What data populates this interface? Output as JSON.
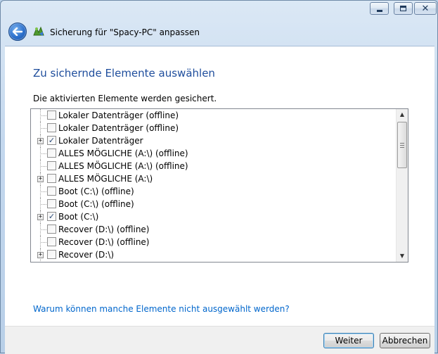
{
  "window": {
    "title": "Sicherung für \"Spacy-PC\" anpassen",
    "controls": {
      "minimize": "minimize-icon",
      "maximize": "maximize-icon",
      "close": "close-icon"
    }
  },
  "page": {
    "heading": "Zu sichernde Elemente auswählen",
    "instruction": "Die aktivierten Elemente werden gesichert."
  },
  "tree": {
    "items": [
      {
        "label": "Lokaler Datenträger (offline)",
        "checked": false,
        "expandable": false
      },
      {
        "label": "Lokaler Datenträger (offline)",
        "checked": false,
        "expandable": false
      },
      {
        "label": "Lokaler Datenträger",
        "checked": true,
        "expandable": true
      },
      {
        "label": "ALLES MÖGLICHE (A:\\) (offline)",
        "checked": false,
        "expandable": false
      },
      {
        "label": "ALLES MÖGLICHE (A:\\) (offline)",
        "checked": false,
        "expandable": false
      },
      {
        "label": "ALLES MÖGLICHE (A:\\)",
        "checked": false,
        "expandable": true
      },
      {
        "label": "Boot (C:\\) (offline)",
        "checked": false,
        "expandable": false
      },
      {
        "label": "Boot (C:\\) (offline)",
        "checked": false,
        "expandable": false
      },
      {
        "label": "Boot (C:\\)",
        "checked": true,
        "expandable": true
      },
      {
        "label": "Recover (D:\\) (offline)",
        "checked": false,
        "expandable": false
      },
      {
        "label": "Recover (D:\\) (offline)",
        "checked": false,
        "expandable": false
      },
      {
        "label": "Recover (D:\\)",
        "checked": false,
        "expandable": true
      }
    ]
  },
  "help_link": "Warum können manche Elemente nicht ausgewählt werden?",
  "buttons": {
    "next": "Weiter",
    "cancel": "Abbrechen"
  }
}
